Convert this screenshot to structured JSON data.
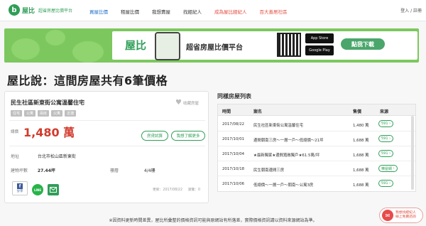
{
  "nav": {
    "logo_letter": "b",
    "logo_name": "屋比",
    "tagline": "超省房屋比價平台",
    "links": [
      {
        "label": "買屋比價",
        "color": "#1f6fc5"
      },
      {
        "label": "租屋比價",
        "color": "#333333"
      },
      {
        "label": "我想賣屋",
        "color": "#333333"
      },
      {
        "label": "找經紀人",
        "color": "#333333"
      },
      {
        "label": "成為屋比經紀人",
        "color": "#e24b3d"
      },
      {
        "label": "百大善居社區",
        "color": "#e24b3d"
      }
    ],
    "login": "登入 / 註冊"
  },
  "banner": {
    "logo": "屋比",
    "title": "超省房屋比價平台",
    "app_store": "App Store",
    "google_play": "Google Play",
    "cta": "點我下載"
  },
  "page_title": "屋比說：這間房屋共有6筆價格",
  "listing": {
    "title": "民生社區新東街公寓溫馨住宅",
    "favorite": "收藏房屋",
    "tags": [
      "住宅",
      "公寓",
      "兩房",
      "公寓",
      "近捷"
    ],
    "price_label": "總價",
    "price": "1,480 萬",
    "loan_button": "房貸試算",
    "inquiry_button": "我想了解更多",
    "address_label": "地址",
    "address": "台北市松山區新東街",
    "area_label": "建物坪數",
    "area": "27.44坪",
    "floor_label": "樓層",
    "floor": "4/4樓",
    "updated": "更新：2017/08/22",
    "views": "瀏覽：0",
    "share_fb": "分享",
    "share_line": "LINE"
  },
  "price_list": {
    "title": "同樣房屋列表",
    "headers": {
      "time": "時間",
      "name": "案名",
      "price": "售價",
      "source": "來源"
    },
    "rows": [
      {
        "time": "2017/08/22",
        "name": "民生社區新東街公寓溫馨住宅",
        "price": "1,480 萬",
        "source": "591"
      },
      {
        "time": "2017/10/01",
        "name": "邊間朝南三房～一層一戶～低總價～21坪",
        "price": "1,688 萬",
        "source": "591"
      },
      {
        "time": "2017/10/04",
        "name": "★最新獨家★邊間寬敞獨戶★61.5萬/坪",
        "price": "1,688 萬",
        "source": "591"
      },
      {
        "time": "2017/10/18",
        "name": "民生朝南邊間三房",
        "price": "1,688 萬",
        "source": "樂屋網"
      },
      {
        "time": "2017/10/06",
        "name": "低總價～一層一戶～朝南～公寓3房",
        "price": "1,688 萬",
        "source": "591"
      }
    ]
  },
  "disclaimer": "※因資料更新時間差異，屋比所彙整的價格資訊可能與原網站有所落差，實際價格資訊請以資料來源網站為準。",
  "float_button": {
    "line1": "我想找經紀人",
    "line2": "線上免費諮詢"
  }
}
